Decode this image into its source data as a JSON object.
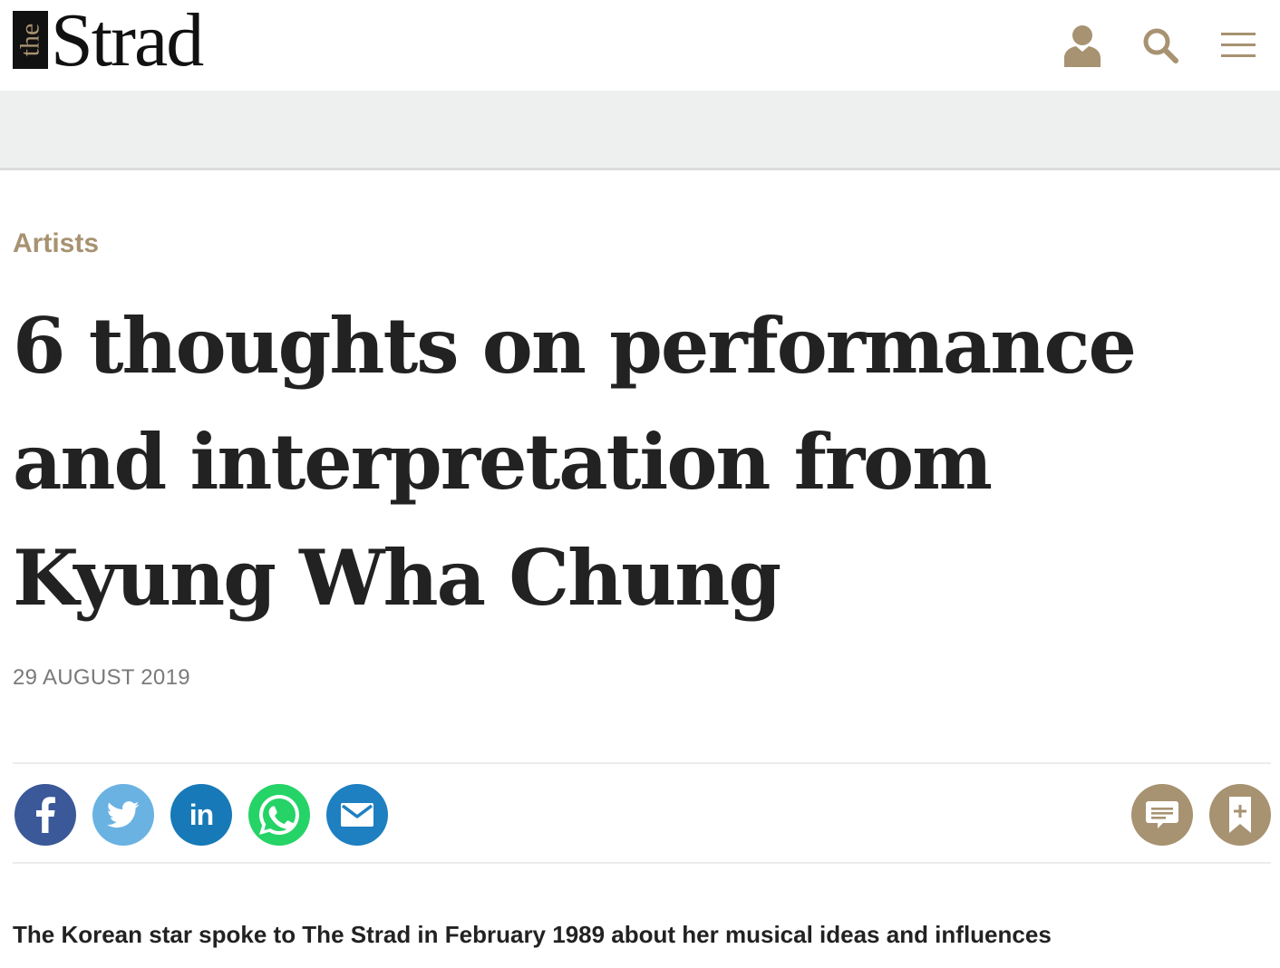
{
  "header": {
    "logo_prefix": "the",
    "logo_word": "Strad",
    "icons": [
      "user-icon",
      "search-icon",
      "menu-icon"
    ]
  },
  "article": {
    "category": "Artists",
    "headline": "6 thoughts on performance and interpretation from Kyung Wha Chung",
    "date": "29 AUGUST 2019",
    "standfirst": "The Korean star spoke to The Strad in February 1989 about her musical ideas and influences"
  },
  "share": {
    "buttons": [
      "facebook-icon",
      "twitter-icon",
      "linkedin-icon",
      "whatsapp-icon",
      "email-icon"
    ],
    "linkedin_glyph": "in",
    "actions": [
      "comment-icon",
      "bookmark-icon"
    ]
  },
  "colors": {
    "brand_gold": "#a79271",
    "facebook": "#3b5998",
    "twitter": "#6ab2e2",
    "linkedin": "#1779b7",
    "whatsapp": "#25d366",
    "email": "#1e7fc1",
    "ad_band": "#eef0ef"
  }
}
